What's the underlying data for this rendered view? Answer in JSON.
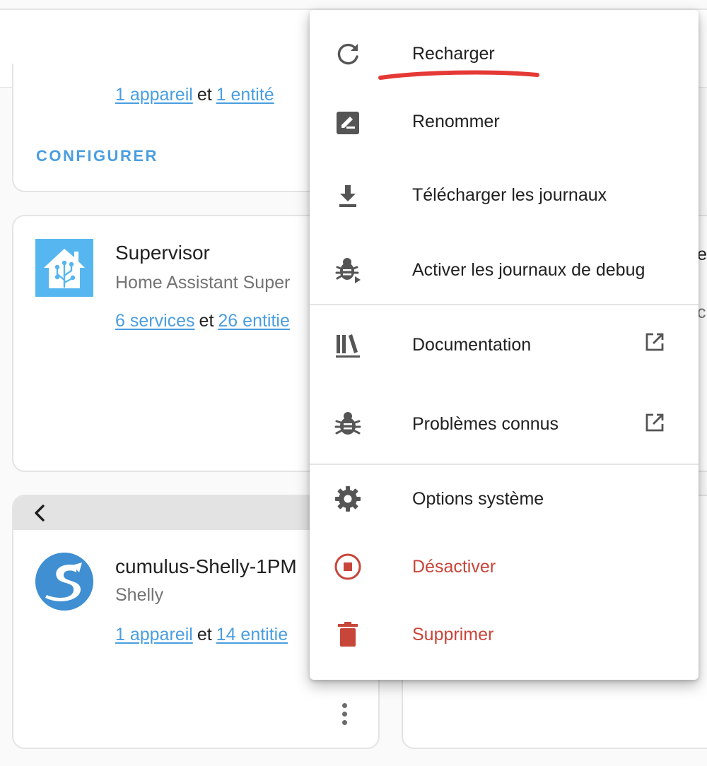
{
  "cards": {
    "top": {
      "link_devices": "1 appareil",
      "conjunction": "et",
      "link_entities": "1 entité",
      "configure_label": "CONFIGURER"
    },
    "supervisor": {
      "title": "Supervisor",
      "subtitle": "Home Assistant Super",
      "link_services": "6 services",
      "conjunction": "et",
      "link_entities": "26 entitie"
    },
    "shelly": {
      "title": "cumulus-Shelly-1PM",
      "subtitle": "Shelly",
      "link_devices": "1 appareil",
      "conjunction": "et",
      "link_entities": "14 entitie"
    },
    "right_fragments": [
      "e",
      "c"
    ]
  },
  "menu": {
    "items": [
      {
        "label": "Recharger",
        "icon": "reload-icon"
      },
      {
        "label": "Renommer",
        "icon": "rename-icon"
      },
      {
        "label": "Télécharger les journaux",
        "icon": "download-icon"
      },
      {
        "label": "Activer les journaux de debug",
        "icon": "bug-play-icon"
      },
      {
        "label": "Documentation",
        "icon": "library-icon",
        "external": "open-in-new-icon"
      },
      {
        "label": "Problèmes connus",
        "icon": "bug-icon",
        "external": "open-in-new-icon"
      },
      {
        "label": "Options système",
        "icon": "gear-icon"
      },
      {
        "label": "Désactiver",
        "icon": "stop-circle-icon"
      },
      {
        "label": "Supprimer",
        "icon": "trash-icon"
      }
    ]
  },
  "colors": {
    "accent": "#4a9ee0",
    "danger": "#c8453a",
    "annotation": "#e53935",
    "ha_logo_bg": "#56b6ef",
    "shelly_logo_bg": "#3f8fd2"
  }
}
